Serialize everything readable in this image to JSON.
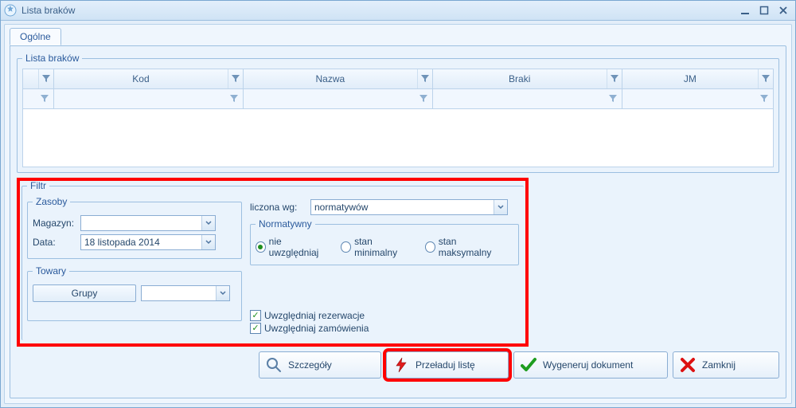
{
  "window": {
    "title": "Lista braków"
  },
  "tabs": {
    "general": "Ogólne"
  },
  "grid": {
    "legend": "Lista braków",
    "columns": {
      "kod": "Kod",
      "nazwa": "Nazwa",
      "braki": "Braki",
      "jm": "JM"
    }
  },
  "filtr": {
    "legend": "Filtr",
    "zasoby": {
      "legend": "Zasoby",
      "magazyn_lbl": "Magazyn:",
      "magazyn_val": "",
      "data_lbl": "Data:",
      "data_val": "18 listopada 2014"
    },
    "towary": {
      "legend": "Towary",
      "grupy_btn": "Grupy",
      "grupa_val": ""
    },
    "liczona_lbl": "liczona wg:",
    "liczona_val": "normatywów",
    "normatywny": {
      "legend": "Normatywny",
      "opt1": "nie uwzględniaj",
      "opt2": "stan minimalny",
      "opt3": "stan maksymalny",
      "selected": "opt1"
    },
    "checks": {
      "rezerwacje": "Uwzględniaj rezerwacje",
      "zamowienia": "Uwzględniaj zamówienia"
    }
  },
  "buttons": {
    "szczegoly": "Szczegóły",
    "przeladuj": "Przeładuj listę",
    "wygeneruj": "Wygeneruj dokument",
    "zamknij": "Zamknij"
  }
}
